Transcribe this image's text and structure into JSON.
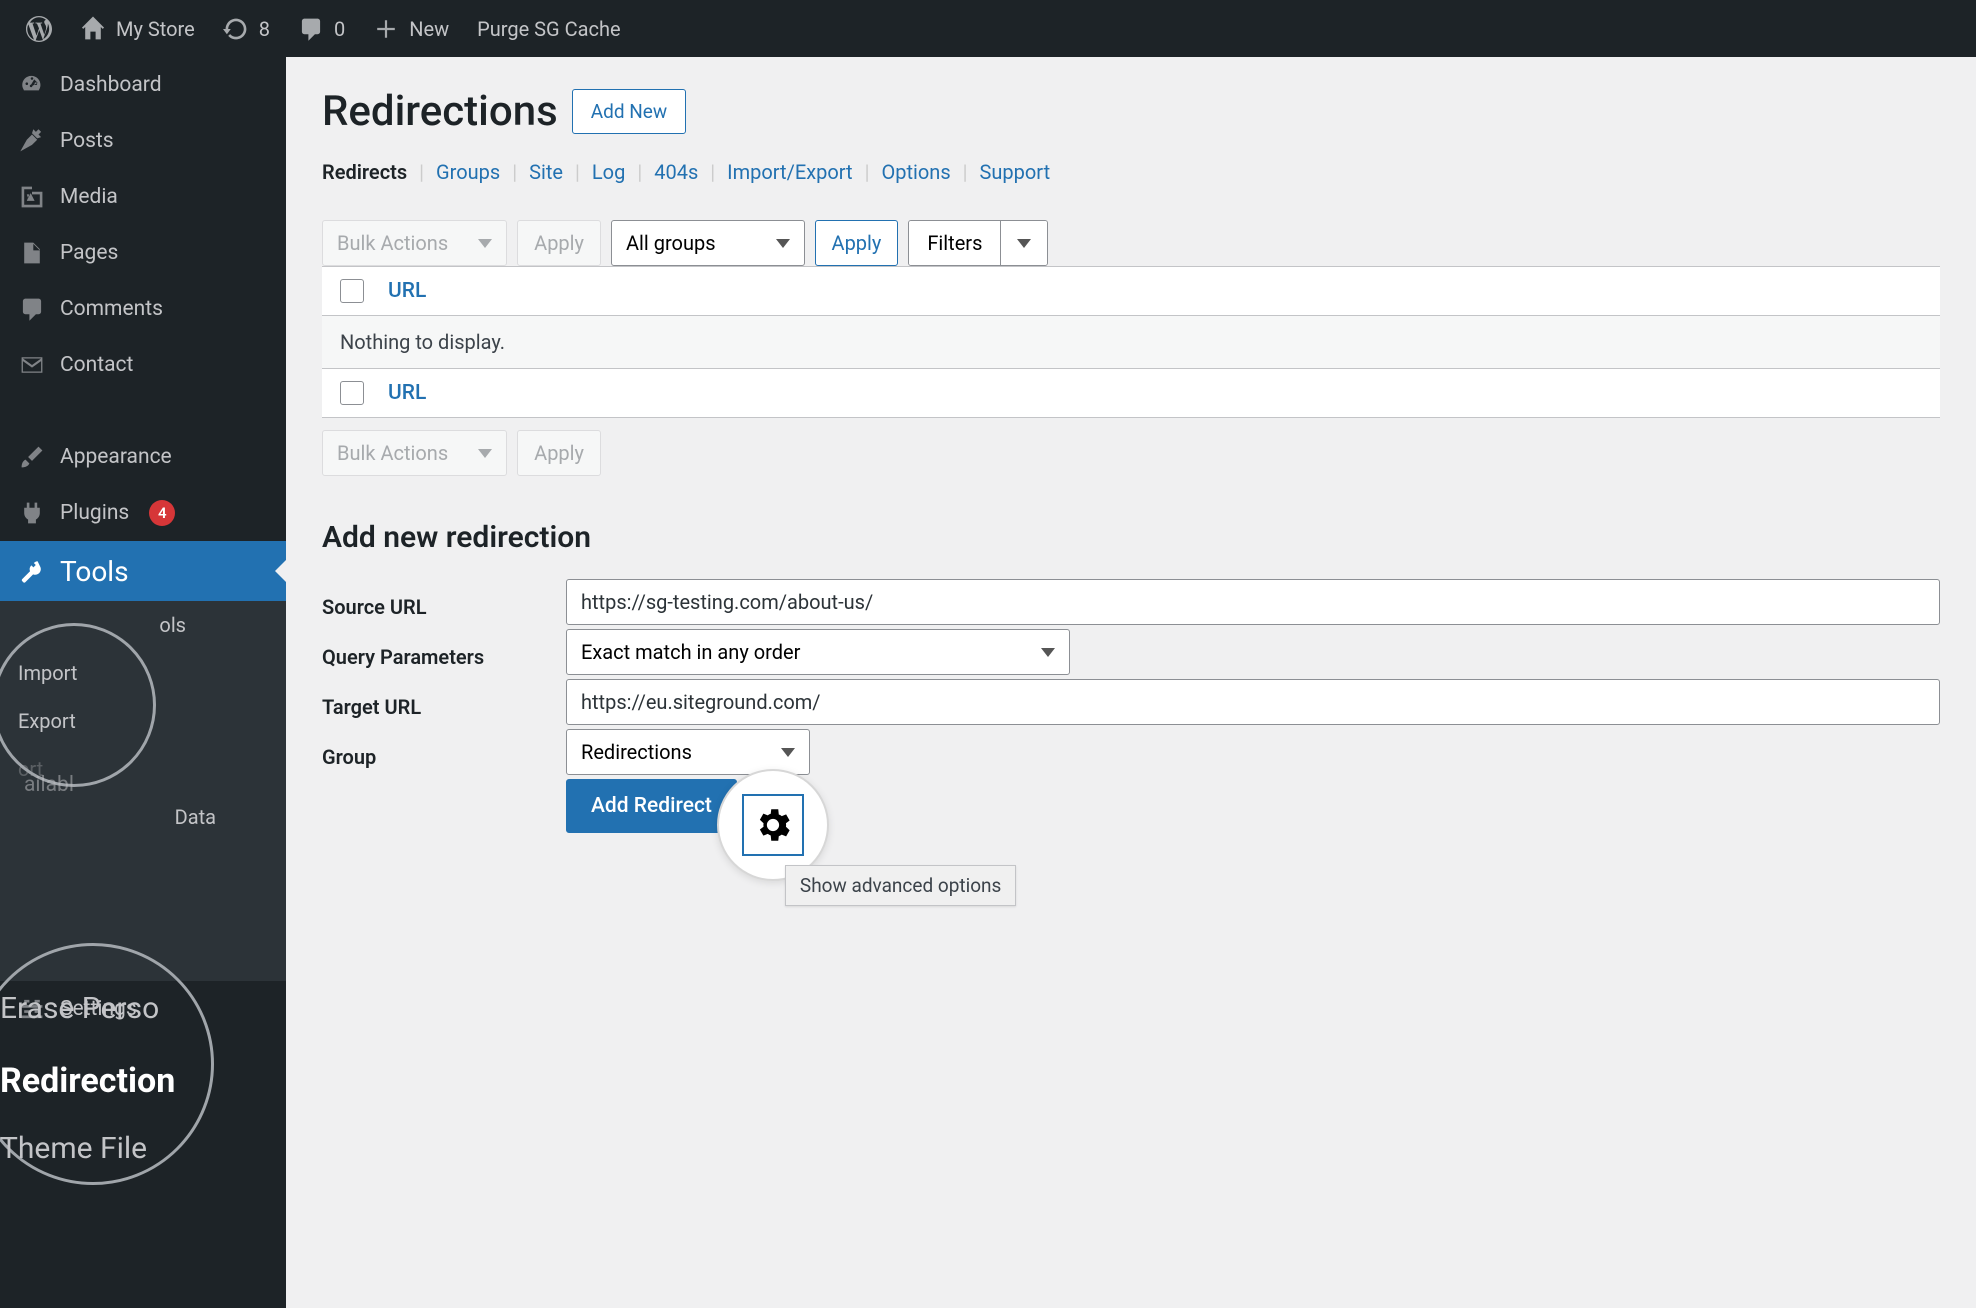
{
  "adminbar": {
    "site_name": "My Store",
    "updates": "8",
    "comments": "0",
    "new": "New",
    "purge": "Purge SG Cache"
  },
  "sidebar": {
    "dashboard": "Dashboard",
    "posts": "Posts",
    "media": "Media",
    "pages": "Pages",
    "comments": "Comments",
    "contact": "Contact",
    "appearance": "Appearance",
    "plugins": "Plugins",
    "plugins_badge": "4",
    "tools": "Tools",
    "submenu_tools_partial": "ols",
    "submenu_import": "Import",
    "submenu_export": "Export",
    "submenu_data_partial": "Data",
    "submenu_redirection": "Redirection",
    "settings": "Settings",
    "overlay_available_partial": "ailabl",
    "overlay_sitehealth_partial": "ort",
    "overlay_erase": "Erase Perso",
    "overlay_themefile": "Theme File"
  },
  "page": {
    "title": "Redirections",
    "add_new": "Add New"
  },
  "subnav": {
    "redirects": "Redirects",
    "groups": "Groups",
    "site": "Site",
    "log": "Log",
    "404s": "404s",
    "import_export": "Import/Export",
    "options": "Options",
    "support": "Support"
  },
  "tablenav": {
    "bulk_actions": "Bulk Actions",
    "apply": "Apply",
    "all_groups": "All groups",
    "filters": "Filters"
  },
  "table": {
    "url_col": "URL",
    "empty": "Nothing to display."
  },
  "form": {
    "heading": "Add new redirection",
    "source_label": "Source URL",
    "source_value": "https://sg-testing.com/about-us/",
    "query_label": "Query Parameters",
    "query_value": "Exact match in any order",
    "target_label": "Target URL",
    "target_value": "https://eu.siteground.com/",
    "group_label": "Group",
    "group_value": "Redirections",
    "submit": "Add Redirect",
    "advanced_tooltip": "Show advanced options"
  }
}
